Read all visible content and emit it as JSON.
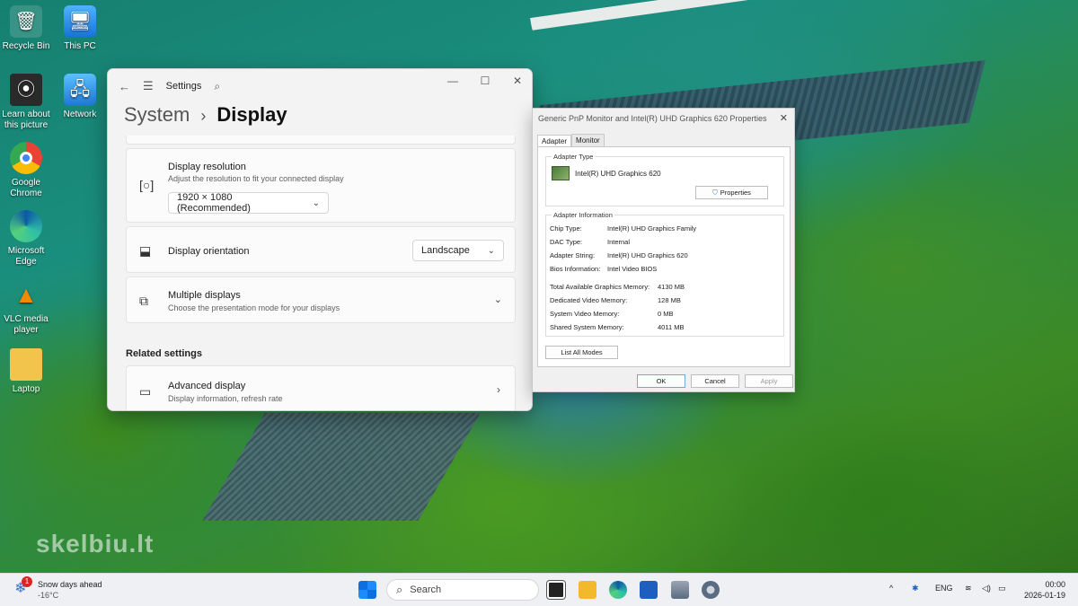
{
  "desktop": {
    "icons": [
      {
        "label": "Recycle Bin",
        "icon": "recycle-bin-icon",
        "glyph": "🗑"
      },
      {
        "label": "This PC",
        "icon": "monitor-icon",
        "glyph": "🖥"
      },
      {
        "label": "Learn about this picture",
        "icon": "learn-about-icon",
        "glyph": "⦿"
      },
      {
        "label": "Network",
        "icon": "network-icon",
        "glyph": "🖧"
      },
      {
        "label": "Google Chrome",
        "icon": "chrome-icon",
        "glyph": "●"
      },
      {
        "label": "Microsoft Edge",
        "icon": "edge-icon",
        "glyph": "◐"
      },
      {
        "label": "VLC media player",
        "icon": "vlc-icon",
        "glyph": "▲"
      },
      {
        "label": "Laptop",
        "icon": "folder-user-icon",
        "glyph": "📁"
      }
    ],
    "watermark": "skelbiu.lt"
  },
  "settings": {
    "app_name": "Settings",
    "breadcrumb_root": "System",
    "breadcrumb_sep": "›",
    "breadcrumb_current": "Display",
    "resolution": {
      "title": "Display resolution",
      "subtitle": "Adjust the resolution to fit your connected display",
      "value": "1920 × 1080 (Recommended)"
    },
    "orientation": {
      "title": "Display orientation",
      "value": "Landscape"
    },
    "multiple": {
      "title": "Multiple displays",
      "subtitle": "Choose the presentation mode for your displays"
    },
    "related_label": "Related settings",
    "advanced": {
      "title": "Advanced display",
      "subtitle": "Display information, refresh rate"
    }
  },
  "properties": {
    "title": "Generic PnP Monitor and Intel(R) UHD Graphics 620 Properties",
    "tabs": [
      "Adapter",
      "Monitor"
    ],
    "active_tab": "Adapter",
    "adapter_type_label": "Adapter Type",
    "adapter_type_value": "Intel(R) UHD Graphics 620",
    "properties_button": "Properties",
    "adapter_info_label": "Adapter Information",
    "info": [
      {
        "k": "Chip Type:",
        "v": "Intel(R) UHD Graphics Family"
      },
      {
        "k": "DAC Type:",
        "v": "Internal"
      },
      {
        "k": "Adapter String:",
        "v": "Intel(R) UHD Graphics 620"
      },
      {
        "k": "Bios Information:",
        "v": "Intel Video BIOS"
      }
    ],
    "memory": [
      {
        "k": "Total Available Graphics Memory:",
        "v": "4130 MB"
      },
      {
        "k": "Dedicated Video Memory:",
        "v": "128 MB"
      },
      {
        "k": "System Video Memory:",
        "v": "0 MB"
      },
      {
        "k": "Shared System Memory:",
        "v": "4011 MB"
      }
    ],
    "list_all_modes": "List All Modes",
    "ok": "OK",
    "cancel": "Cancel",
    "apply": "Apply"
  },
  "taskbar": {
    "weather_title": "Snow days ahead",
    "weather_temp": "-16°C",
    "weather_badge": "1",
    "search_placeholder": "Search",
    "lang": "ENG",
    "time": "00:00",
    "date": "2026-01-19"
  }
}
